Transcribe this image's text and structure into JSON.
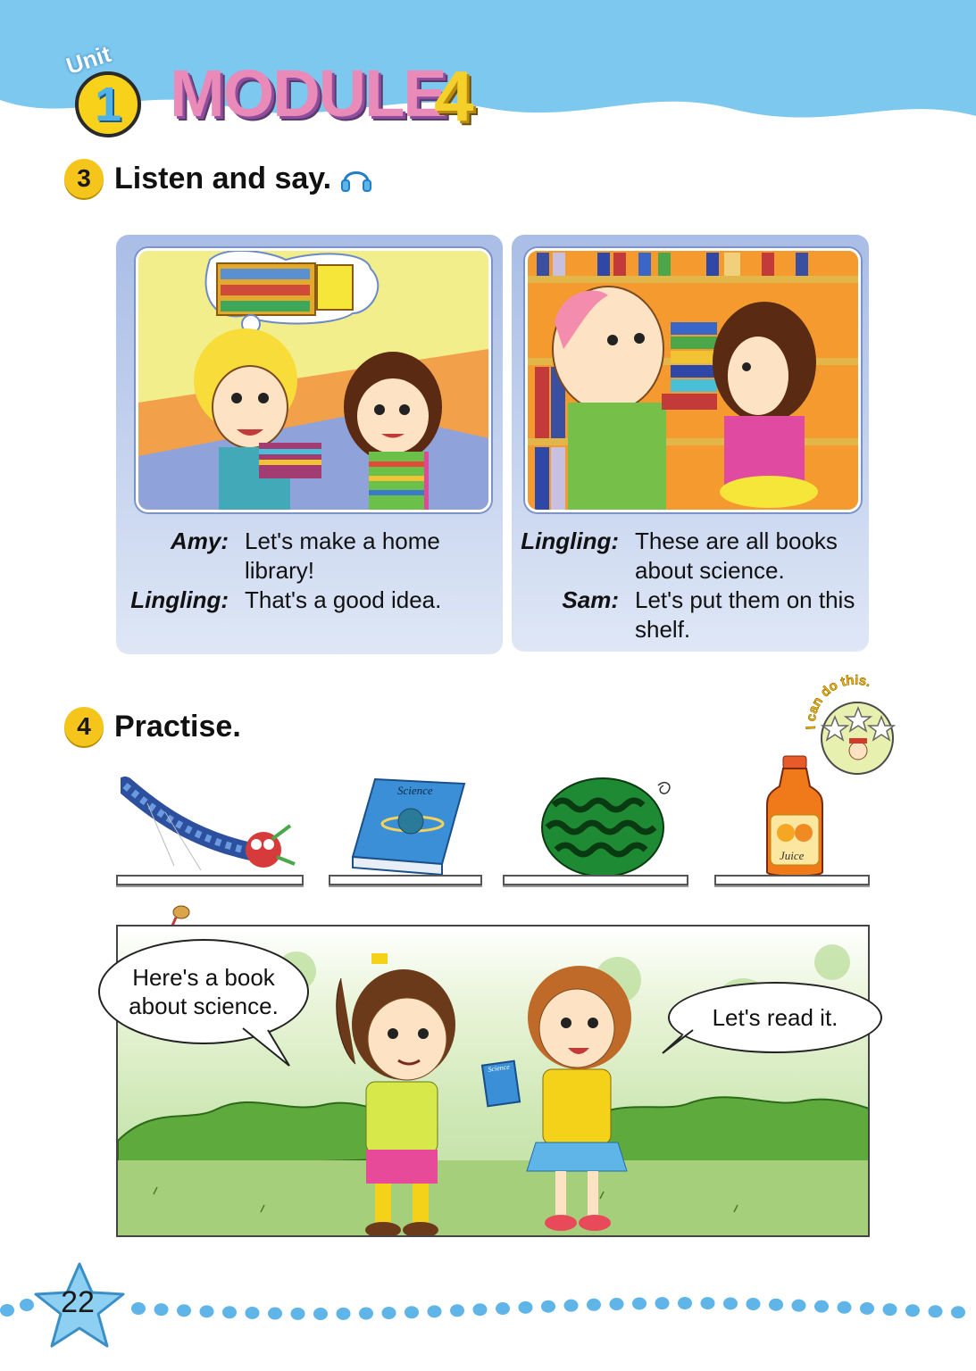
{
  "header": {
    "unit_word": "Unit",
    "unit_number": "1",
    "module_title": "MODULE",
    "module_number": "4"
  },
  "section3": {
    "number": "3",
    "title": "Listen and say.",
    "panels": [
      {
        "lines": [
          {
            "speaker": "Amy:",
            "text": "Let's make a home library!"
          },
          {
            "speaker": "Lingling:",
            "text": "That's a good idea."
          }
        ]
      },
      {
        "lines": [
          {
            "speaker": "Lingling:",
            "text": "These are all books about science."
          },
          {
            "speaker": "Sam:",
            "text": "Let's put them on this shelf."
          }
        ]
      }
    ]
  },
  "section4": {
    "number": "4",
    "title": "Practise.",
    "badge_text": "I can do this.",
    "items": [
      {
        "icon": "dragon-kite-icon"
      },
      {
        "icon": "science-book-icon",
        "label": "Science"
      },
      {
        "icon": "watermelon-icon"
      },
      {
        "icon": "juice-bottle-icon",
        "label": "Juice"
      }
    ],
    "bubbles": {
      "left": "Here's a book about science.",
      "right": "Let's read it."
    },
    "book_label": "Science"
  },
  "footer": {
    "page_number": "22"
  },
  "colors": {
    "sky": "#7cc8ef",
    "badge_yellow": "#f6c51b",
    "panel_blue": "#a9bde6",
    "dots": "#5fb4e8"
  }
}
